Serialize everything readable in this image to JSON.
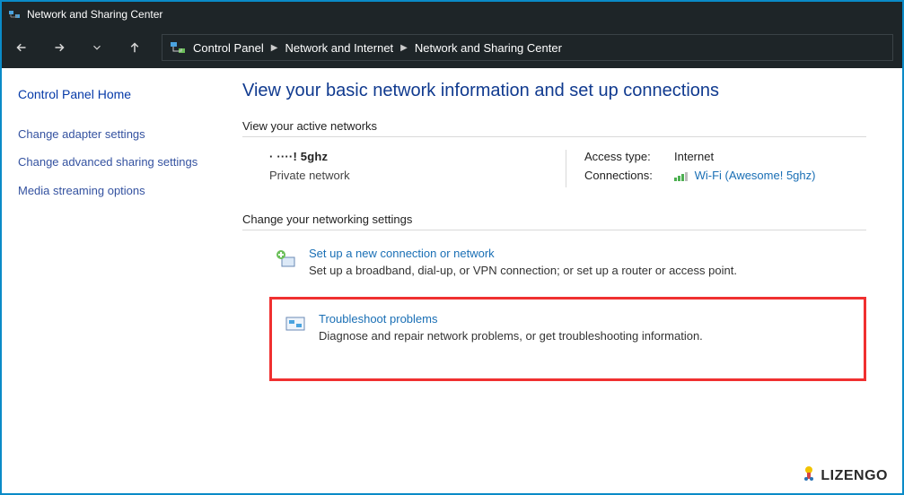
{
  "window": {
    "title": "Network and Sharing Center"
  },
  "breadcrumb": {
    "items": [
      "Control Panel",
      "Network and Internet",
      "Network and Sharing Center"
    ]
  },
  "sidebar": {
    "home": "Control Panel Home",
    "items": [
      "Change adapter settings",
      "Change advanced sharing settings",
      "Media streaming options"
    ]
  },
  "main": {
    "title": "View your basic network information and set up connections",
    "active_section": "View your active networks",
    "network": {
      "name_masked": "·    ····! 5ghz",
      "type": "Private network",
      "access_label": "Access type:",
      "access_value": "Internet",
      "conn_label": "Connections:",
      "conn_value": "Wi-Fi (Awesome! 5ghz)"
    },
    "change_section": "Change your networking settings",
    "settings": [
      {
        "link": "Set up a new connection or network",
        "desc": "Set up a broadband, dial-up, or VPN connection; or set up a router or access point."
      },
      {
        "link": "Troubleshoot problems",
        "desc": "Diagnose and repair network problems, or get troubleshooting information."
      }
    ]
  },
  "brand": "LIZENGO"
}
